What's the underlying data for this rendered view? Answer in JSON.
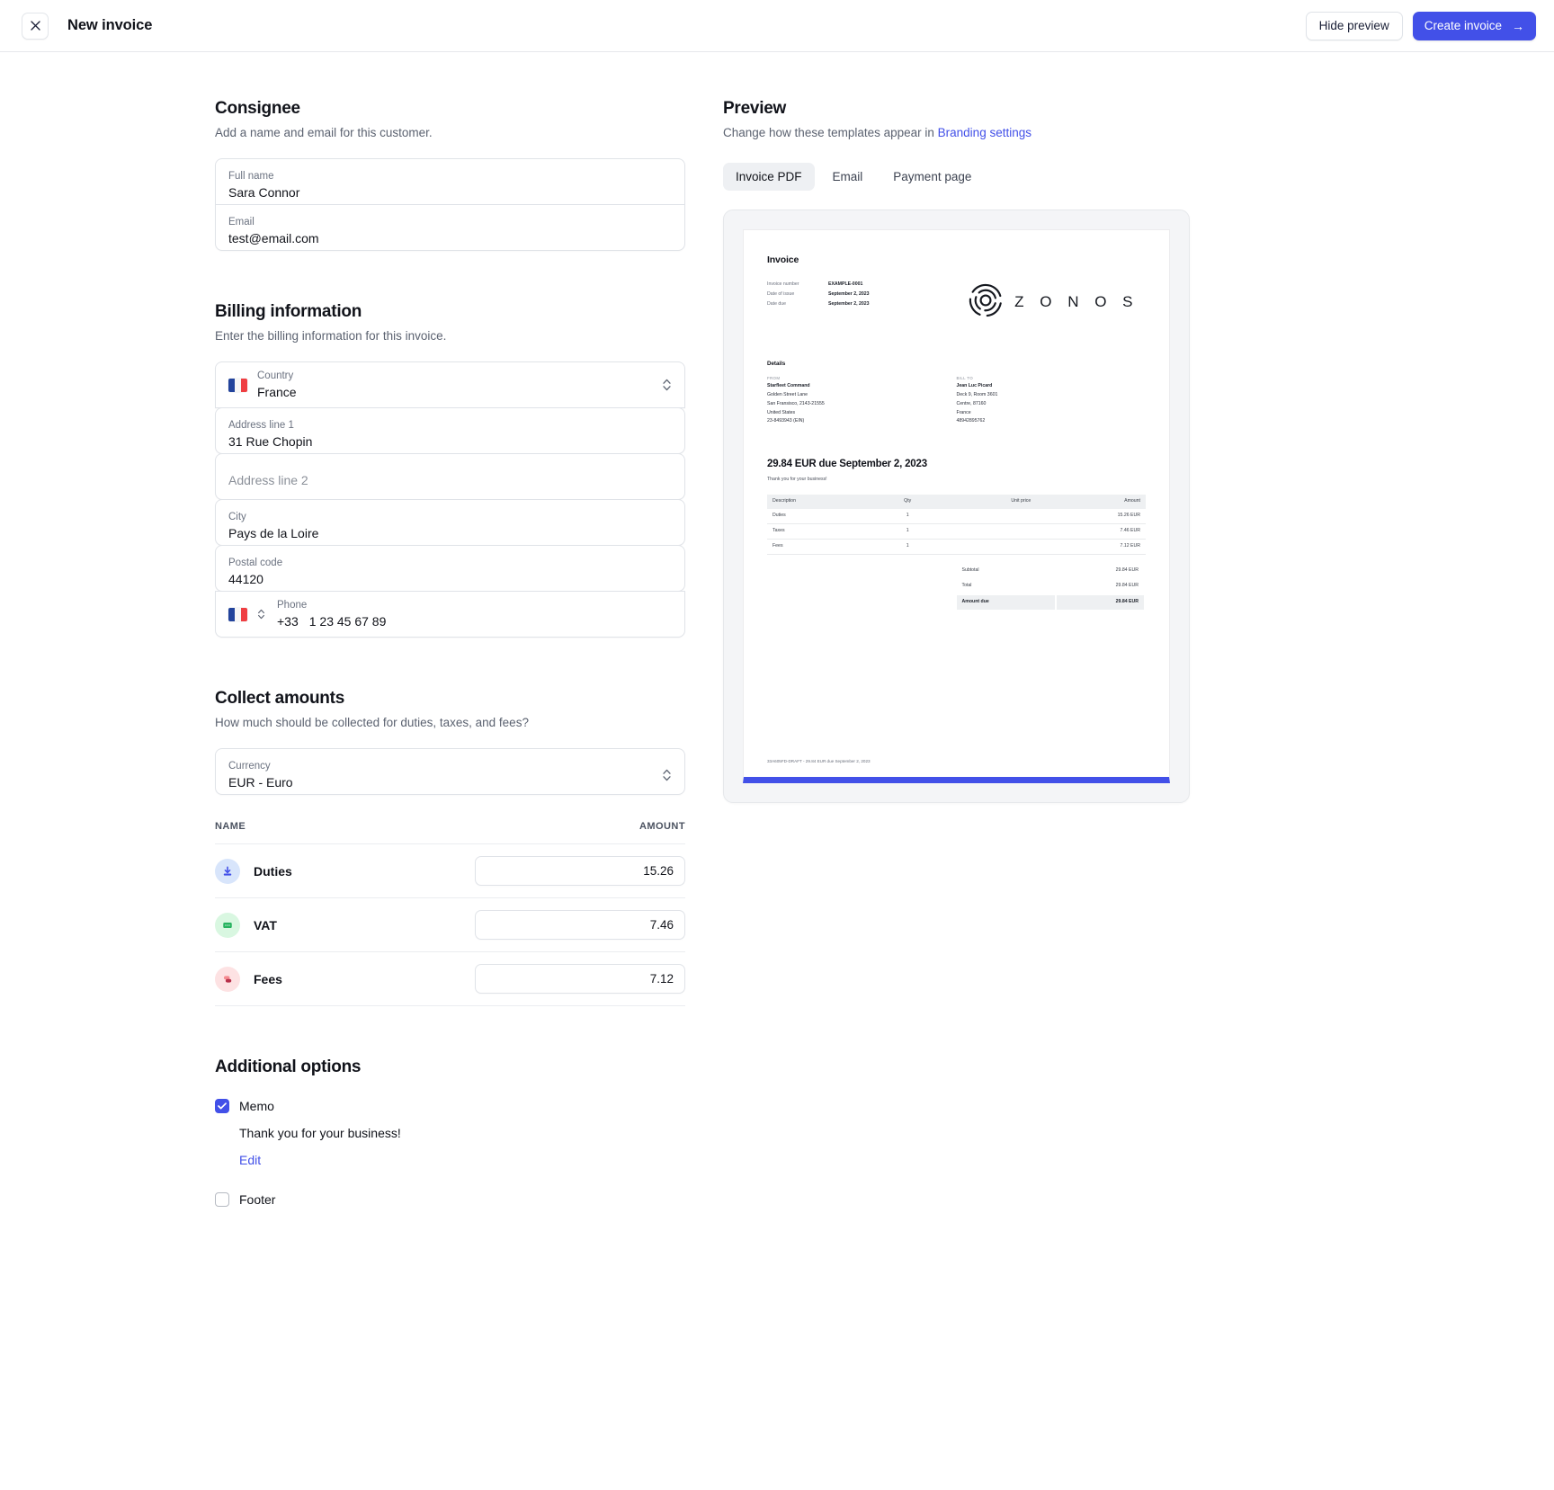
{
  "topbar": {
    "close_icon": "close-icon",
    "title": "New invoice",
    "hide_preview_label": "Hide preview",
    "create_invoice_label": "Create invoice",
    "create_invoice_arrow": "→",
    "primary_color": "#4250e8"
  },
  "consignee": {
    "title": "Consignee",
    "subtitle": "Add a name and email for this customer.",
    "full_name": {
      "label": "Full name",
      "value": "Sara Connor"
    },
    "email": {
      "label": "Email",
      "value": "test@email.com"
    }
  },
  "billing": {
    "title": "Billing information",
    "subtitle": "Enter the billing information for this invoice.",
    "country": {
      "label": "Country",
      "value": "France",
      "flag": "fr-flag-icon"
    },
    "address1": {
      "label": "Address line 1",
      "value": "31 Rue Chopin"
    },
    "address2": {
      "label": "Address line 2",
      "placeholder": "Address line 2",
      "value": ""
    },
    "city": {
      "label": "City",
      "value": "Pays de la Loire"
    },
    "postal": {
      "label": "Postal code",
      "value": "44120"
    },
    "phone": {
      "label": "Phone",
      "prefix": "+33",
      "value": "1 23 45 67 89",
      "flag": "fr-flag-icon"
    }
  },
  "collect": {
    "title": "Collect amounts",
    "subtitle": "How much should be collected for duties, taxes, and fees?",
    "currency": {
      "label": "Currency",
      "value": "EUR - Euro"
    },
    "columns": {
      "name": "NAME",
      "amount": "AMOUNT"
    },
    "rows": [
      {
        "label": "Duties",
        "amount": "15.26",
        "icon": "duties-download-icon",
        "icon_bg": "#d8e5fb",
        "icon_fg": "#4250e8"
      },
      {
        "label": "VAT",
        "amount": "7.46",
        "icon": "vat-receipt-icon",
        "icon_bg": "#d9f7e1",
        "icon_fg": "#1fa85a"
      },
      {
        "label": "Fees",
        "amount": "7.12",
        "icon": "fees-tag-icon",
        "icon_bg": "#fde2e3",
        "icon_fg": "#c0354b"
      }
    ]
  },
  "additional": {
    "title": "Additional options",
    "memo": {
      "label": "Memo",
      "checked": true,
      "text": "Thank you for your business!",
      "edit_label": "Edit"
    },
    "footer": {
      "label": "Footer",
      "checked": false
    }
  },
  "preview": {
    "title": "Preview",
    "subtitle_prefix": "Change how these templates appear in ",
    "subtitle_link": "Branding settings",
    "tabs": [
      {
        "label": "Invoice PDF",
        "active": true
      },
      {
        "label": "Email",
        "active": false
      },
      {
        "label": "Payment page",
        "active": false
      }
    ],
    "document": {
      "title": "Invoice",
      "meta": [
        {
          "key": "Invoice number",
          "value": "EXAMPLE-0001"
        },
        {
          "key": "Date of issue",
          "value": "September 2, 2023"
        },
        {
          "key": "Date due",
          "value": "September 2, 2023"
        }
      ],
      "brand_name": "Z O N O S",
      "details_heading": "Details",
      "from": {
        "caption": "FROM",
        "name": "Starfleet Command",
        "lines": [
          "Golden Street Lane",
          "San Fransisco, 2143-21555",
          "United States",
          "23-8493943 (EIN)"
        ]
      },
      "bill_to": {
        "caption": "BILL TO",
        "name": "Jean Luc Picard",
        "lines": [
          "Deck 9, Room 3601",
          "Centre, 87160",
          "France",
          "48942895762"
        ]
      },
      "due_line": "29.84 EUR due September 2, 2023",
      "memo": "Thank you for your business!",
      "table": {
        "headers": [
          "Description",
          "Qty",
          "Unit price",
          "Amount"
        ],
        "rows": [
          {
            "description": "Duties",
            "qty": "1",
            "unit_price": "",
            "amount": "15.26 EUR"
          },
          {
            "description": "Taxes",
            "qty": "1",
            "unit_price": "",
            "amount": "7.46 EUR"
          },
          {
            "description": "Fees",
            "qty": "1",
            "unit_price": "",
            "amount": "7.12 EUR"
          }
        ]
      },
      "totals": [
        {
          "label": "Subtotal",
          "value": "29.84 EUR",
          "highlight": false
        },
        {
          "label": "Total",
          "value": "29.84 EUR",
          "highlight": false
        },
        {
          "label": "Amount due",
          "value": "29.84 EUR",
          "highlight": true
        }
      ],
      "footer": "33A605FD-DRAFT - 29.84 EUR due September 2, 2023"
    }
  }
}
